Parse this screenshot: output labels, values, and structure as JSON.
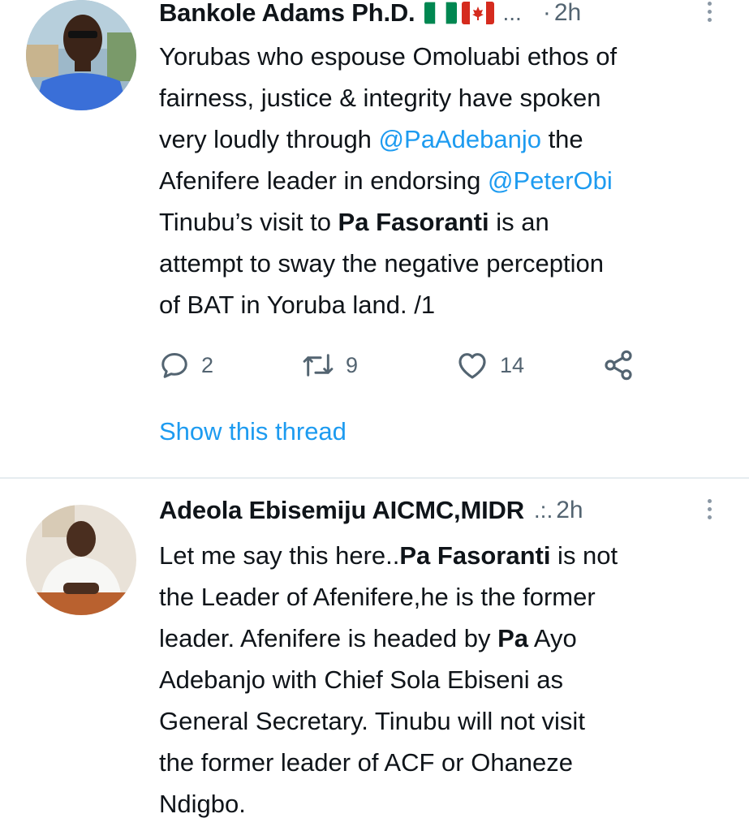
{
  "tweets": [
    {
      "author": {
        "name": "Bankole Adams Ph.D.",
        "flags": [
          "flag-nigeria",
          "flag-canada"
        ],
        "ellipsis": "...",
        "separator": "·",
        "time": "2h"
      },
      "text_lines": [
        [
          {
            "t": "Yorubas who espouse Omoluabi ethos of"
          }
        ],
        [
          {
            "t": "fairness, justice & integrity have spoken"
          }
        ],
        [
          {
            "t": "very loudly through "
          },
          {
            "t": "@PaAdebanjo",
            "mention": true
          },
          {
            "t": " the"
          }
        ],
        [
          {
            "t": "Afenifere leader in endorsing "
          },
          {
            "t": "@PeterObi",
            "mention": true
          }
        ],
        [
          {
            "t": "Tinubu’s visit to "
          },
          {
            "t": "Pa Fasoranti",
            "bold": true
          },
          {
            "t": " is an"
          }
        ],
        [
          {
            "t": "attempt to sway the negative perception"
          }
        ],
        [
          {
            "t": "of BAT in Yoruba land. /1"
          }
        ]
      ],
      "actions": {
        "reply_count": "2",
        "retweet_count": "9",
        "like_count": "14"
      },
      "show_thread": "Show this thread"
    },
    {
      "author": {
        "name": "Adeola Ebisemiju AICMC,MIDR",
        "ellipsis": ".:.",
        "time": "2h"
      },
      "text_lines": [
        [
          {
            "t": "Let me say this here.."
          },
          {
            "t": "Pa Fasoranti",
            "bold": true
          },
          {
            "t": " is not"
          }
        ],
        [
          {
            "t": "the Leader of Afenifere,he is the former"
          }
        ],
        [
          {
            "t": "leader. Afenifere is headed by "
          },
          {
            "t": "Pa",
            "bold": true
          },
          {
            "t": " Ayo"
          }
        ],
        [
          {
            "t": "Adebanjo with Chief Sola Ebiseni as"
          }
        ],
        [
          {
            "t": "General Secretary. Tinubu will not visit"
          }
        ],
        [
          {
            "t": "the former leader of ACF or Ohaneze"
          }
        ],
        [
          {
            "t": "Ndigbo."
          }
        ]
      ]
    }
  ],
  "colors": {
    "text": "#0f1419",
    "secondary": "#536471",
    "accent": "#1d9bf0",
    "divider": "#e6ecf0"
  },
  "icons": {
    "reply": "reply-icon",
    "retweet": "retweet-icon",
    "like": "heart-icon",
    "share": "share-icon",
    "more": "more-vertical-icon"
  }
}
